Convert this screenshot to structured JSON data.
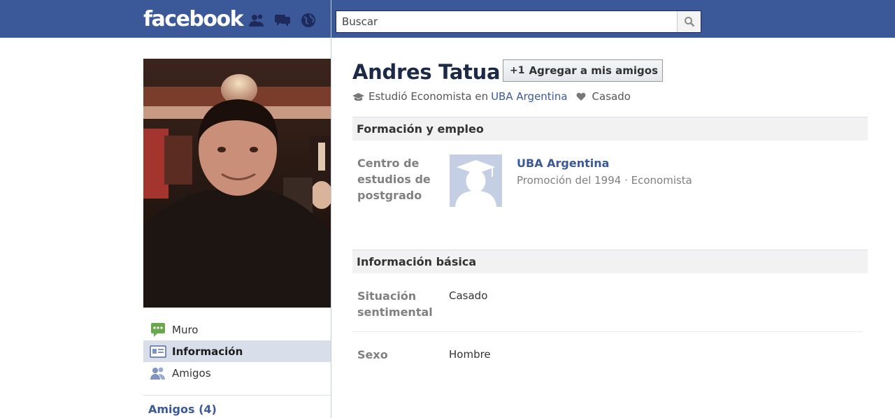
{
  "header": {
    "logo": "facebook",
    "search_placeholder": "Buscar"
  },
  "left": {
    "nav": [
      {
        "label": "Muro"
      },
      {
        "label": "Información"
      },
      {
        "label": "Amigos"
      }
    ],
    "friends_title": "Amigos (4)"
  },
  "profile": {
    "name": "Andres Tatua",
    "add_friend_label": "Agregar a mis amigos",
    "studied_prefix": "Estudió Economista en",
    "studied_school": "UBA Argentina",
    "relationship": "Casado"
  },
  "education": {
    "section_title": "Formación y empleo",
    "label": "Centro de estudios de postgrado",
    "school": "UBA Argentina",
    "detail": "Promoción del 1994 · Economista"
  },
  "basic": {
    "section_title": "Información básica",
    "rows": [
      {
        "label": "Situación sentimental",
        "value": "Casado"
      },
      {
        "label": "Sexo",
        "value": "Hombre"
      }
    ]
  },
  "colors": {
    "brand_blue": "#3b5998",
    "selected_nav": "#d8dfea"
  }
}
